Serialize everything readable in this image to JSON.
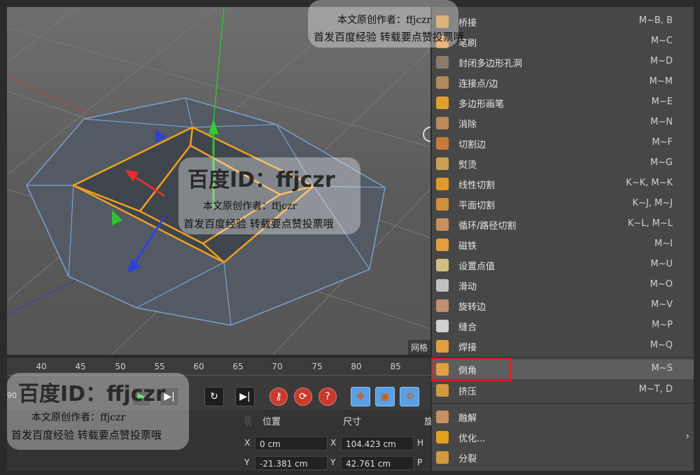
{
  "viewport": {
    "corner_label": "网格"
  },
  "timeline": {
    "ticks": [
      "40",
      "45",
      "50",
      "55",
      "60",
      "65",
      "70",
      "75",
      "80",
      "85"
    ],
    "left_frame": "90"
  },
  "controls": {
    "goto_end_icon": "skip-end-icon",
    "loop_icon": "loop-icon"
  },
  "attributes": {
    "position_header": "位置",
    "size_header": "尺寸",
    "rotation_header": "旋",
    "x_axis": "X",
    "y_axis": "Y",
    "h_axis": "H",
    "p_axis": "P",
    "pos_x": "0 cm",
    "pos_y": "-21.381 cm",
    "size_x": "104.423 cm",
    "size_y": "42.761 cm"
  },
  "menu": {
    "items": [
      {
        "label": "桥接",
        "shortcut": "M~B, B",
        "color": "#c98a3a"
      },
      {
        "label": "笔刷",
        "shortcut": "M~C",
        "color": "#d8913a"
      },
      {
        "label": "封闭多边形孔洞",
        "shortcut": "M~D",
        "color": "#8a7a6a"
      },
      {
        "label": "连接点/边",
        "shortcut": "M~M",
        "color": "#b08a5a"
      },
      {
        "label": "多边形画笔",
        "shortcut": "M~E",
        "color": "#e0a030"
      },
      {
        "label": "消除",
        "shortcut": "M~N",
        "color": "#b88a5a"
      },
      {
        "label": "切割边",
        "shortcut": "M~F",
        "color": "#c87a3a"
      },
      {
        "label": "熨烫",
        "shortcut": "M~G",
        "color": "#c8a050"
      },
      {
        "label": "线性切割",
        "shortcut": "K~K, M~K",
        "color": "#e09a2a"
      },
      {
        "label": "平面切割",
        "shortcut": "K~J, M~J",
        "color": "#d09040"
      },
      {
        "label": "循环/路径切割",
        "shortcut": "K~L, M~L",
        "color": "#c89060"
      },
      {
        "label": "磁铁",
        "shortcut": "M~I",
        "color": "#e0a040"
      },
      {
        "label": "设置点值",
        "shortcut": "M~U",
        "color": "#d0c080"
      },
      {
        "label": "滑动",
        "shortcut": "M~O",
        "color": "#c0c0c0"
      },
      {
        "label": "旋转边",
        "shortcut": "M~V",
        "color": "#c09070"
      },
      {
        "label": "缝合",
        "shortcut": "M~P",
        "color": "#d0d0d0"
      },
      {
        "label": "焊接",
        "shortcut": "M~Q",
        "color": "#e0a040"
      },
      {
        "label": "倒角",
        "shortcut": "M~S",
        "color": "#e0a040"
      },
      {
        "label": "挤压",
        "shortcut": "M~T, D",
        "color": "#d09a40"
      },
      {
        "label": "融解",
        "shortcut": "",
        "color": "#c89060"
      },
      {
        "label": "优化...",
        "shortcut": "",
        "color": "#e0a020"
      },
      {
        "label": "分裂",
        "shortcut": "",
        "color": "#d09a40"
      }
    ]
  },
  "watermarks": {
    "top_line1": "本文原创作者：ffjczr",
    "top_line2": "首发百度经验 转载要点赞投票哦",
    "mid_title": "百度ID：ffjczr",
    "mid_line1": "本文原创作者：ffjczr",
    "mid_line2": "首发百度经验 转载要点赞投票哦",
    "bottom_title": "百度ID：ffjczr",
    "bottom_line1": "本文原创作者：ffjczr",
    "bottom_line2": "首发百度经验 转载要点赞投票哦"
  }
}
